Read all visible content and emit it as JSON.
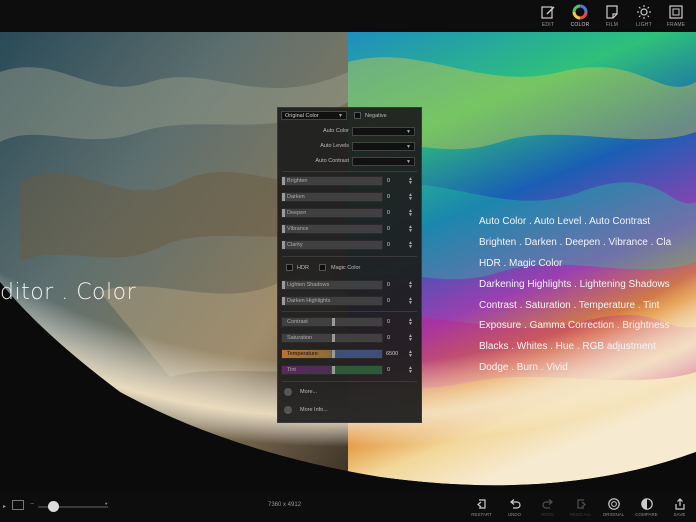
{
  "toolbar": {
    "tools": [
      {
        "label": "EDIT",
        "icon": "edit-icon"
      },
      {
        "label": "COLOR",
        "icon": "color-wheel-icon"
      },
      {
        "label": "FILM",
        "icon": "film-icon"
      },
      {
        "label": "LIGHT",
        "icon": "light-icon"
      },
      {
        "label": "FRAME",
        "icon": "frame-icon"
      }
    ]
  },
  "canvas": {
    "title": "ditor . Color",
    "features": [
      "Auto Color . Auto Level . Auto Contrast",
      "Brighten . Darken . Deepen . Vibrance . Cla",
      "HDR . Magic Color",
      "Darkening Highlights . Lightening Shadows",
      "Contrast . Saturation . Temperature . Tint",
      "Exposure . Gamma Correction . Brightness",
      "Blacks . Whites . Hue . RGB adjustment",
      "Dodge . Burn . Vivid"
    ]
  },
  "panel": {
    "preset_value": "Original Color",
    "negative_label": "Negative",
    "auto_color_label": "Auto Color",
    "auto_levels_label": "Auto Levels",
    "auto_contrast_label": "Auto Contrast",
    "group1": [
      {
        "label": "Brighten",
        "value": "0",
        "level": 0
      },
      {
        "label": "Darken",
        "value": "0",
        "level": 0
      },
      {
        "label": "Deepen",
        "value": "0",
        "level": 0
      },
      {
        "label": "Vibrance",
        "value": "0",
        "level": 0
      },
      {
        "label": "Clarity",
        "value": "0",
        "level": 0
      }
    ],
    "hdr_label": "HDR",
    "magic_color_label": "Magic Color",
    "group2": [
      {
        "label": "Lighten Shadows",
        "value": "0"
      },
      {
        "label": "Darken Highlights",
        "value": "0"
      }
    ],
    "group3": [
      {
        "label": "Contrast",
        "value": "0",
        "color": "#404040"
      },
      {
        "label": "Saturation",
        "value": "0",
        "color": "#404040"
      },
      {
        "label": "Temperature",
        "value": "6500",
        "color": "#3e4f7a"
      },
      {
        "label": "Tint",
        "value": "0",
        "color": "#2f5a3a"
      }
    ],
    "more_label": "More...",
    "more_info_label": "More Info..."
  },
  "bottom": {
    "dimensions": "7360 x 4912",
    "tools": [
      {
        "label": "RESTART",
        "icon": "restart-icon",
        "enabled": true
      },
      {
        "label": "UNDO",
        "icon": "undo-icon",
        "enabled": true
      },
      {
        "label": "REDO",
        "icon": "redo-icon",
        "enabled": false
      },
      {
        "label": "REDO ALL",
        "icon": "redo-all-icon",
        "enabled": false
      },
      {
        "label": "ORIGINAL",
        "icon": "original-icon",
        "enabled": true
      },
      {
        "label": "COMPARE",
        "icon": "compare-icon",
        "enabled": true
      },
      {
        "label": "SAVE",
        "icon": "share-icon",
        "enabled": true
      }
    ],
    "zoom_level": 0.22
  }
}
